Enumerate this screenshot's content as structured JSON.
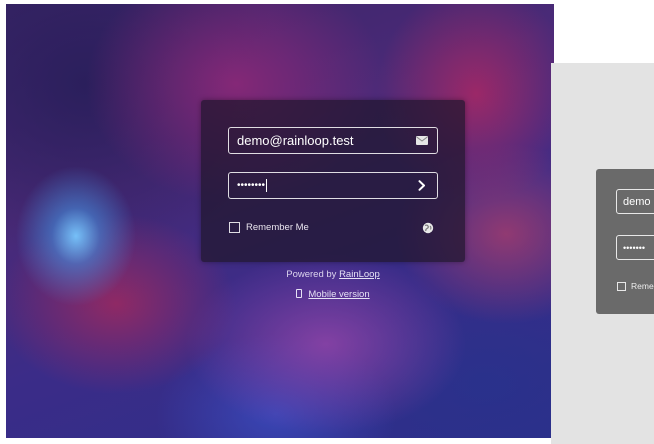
{
  "login": {
    "email_value": "demo@rainloop.test",
    "password_masked": "••••••••",
    "remember_label": "Remember Me",
    "powered_prefix": "Powered by",
    "powered_link": "RainLoop",
    "mobile_label": "Mobile version",
    "icons": {
      "email": "envelope-icon",
      "submit": "chevron-right-icon",
      "language": "globe-icon",
      "mobile": "mobile-phone-icon"
    }
  },
  "secondary_login": {
    "email_value": "demo",
    "password_masked": "•••••••",
    "remember_label": "Reme"
  },
  "colors": {
    "card_background": "#20162c",
    "secondary_panel": "#e3e3e3",
    "secondary_card": "#6a6a6a",
    "text_light": "#ffffff"
  }
}
